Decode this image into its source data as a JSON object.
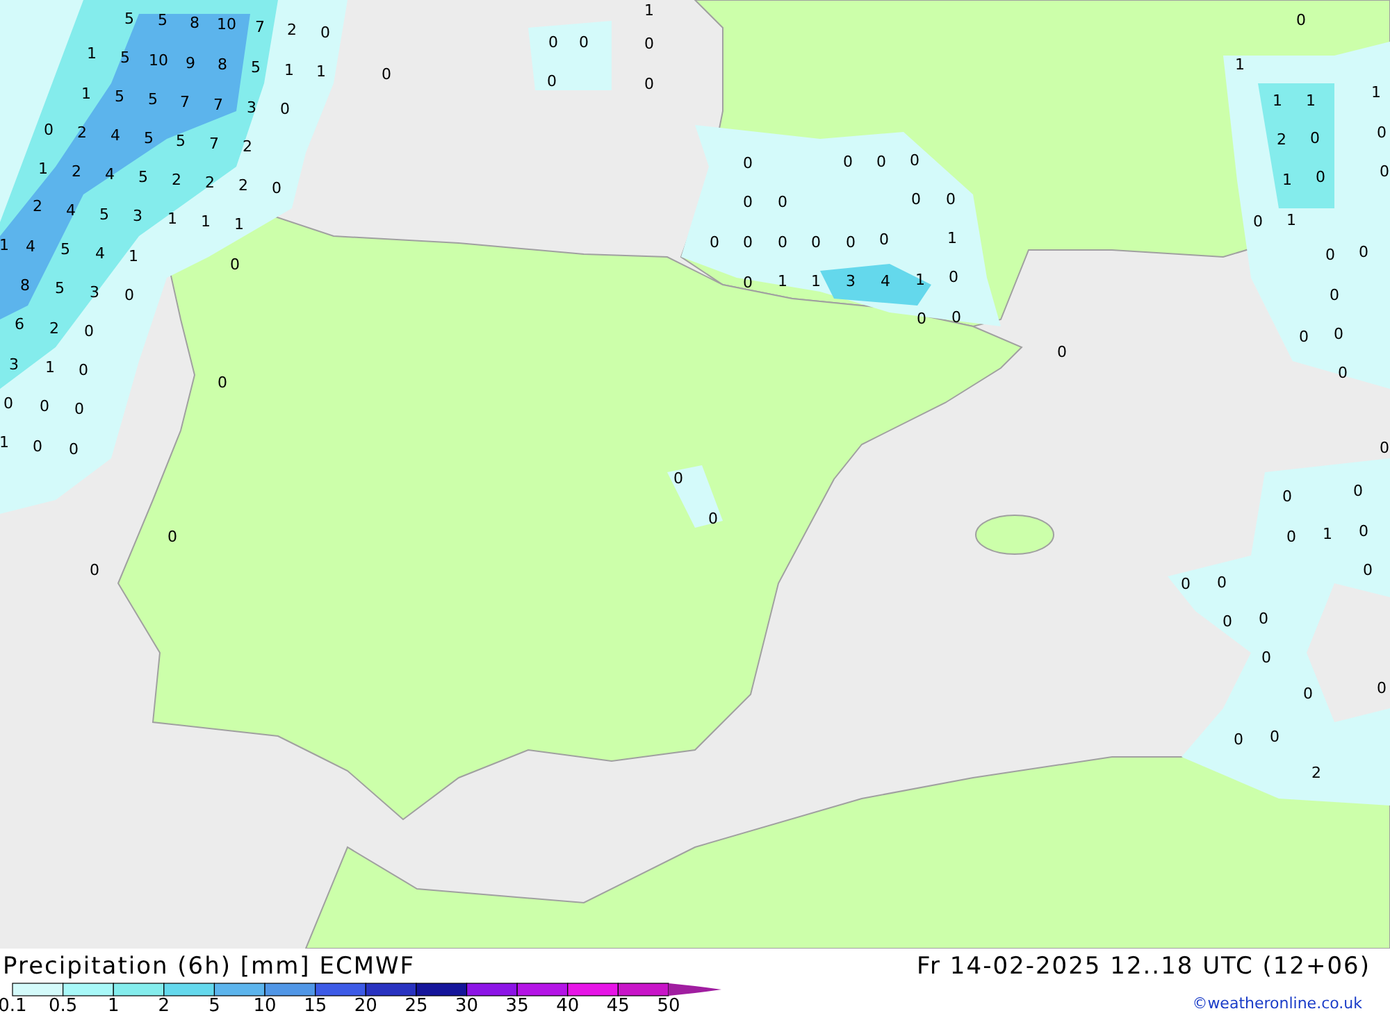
{
  "map": {
    "values": [
      "5",
      "5",
      "8",
      "10",
      "7",
      "2",
      "0",
      "1",
      "5",
      "10",
      "9",
      "8",
      "5",
      "1",
      "1",
      "0",
      "1",
      "5",
      "5",
      "7",
      "7",
      "3",
      "0",
      "0",
      "2",
      "4",
      "5",
      "5",
      "7",
      "2",
      "1",
      "2",
      "4",
      "5",
      "2",
      "2",
      "2",
      "0",
      "2",
      "4",
      "5",
      "3",
      "1",
      "1",
      "1",
      "1",
      "4",
      "5",
      "4",
      "1",
      "0",
      "8",
      "5",
      "3",
      "0",
      "6",
      "2",
      "0",
      "3",
      "1",
      "0",
      "0",
      "0",
      "0",
      "0",
      "1",
      "0",
      "0",
      "1",
      "0",
      "0",
      "0",
      "0",
      "0",
      "0",
      "0",
      "0",
      "0",
      "0",
      "0",
      "0",
      "0",
      "0",
      "0",
      "0",
      "0",
      "0",
      "0",
      "1",
      "0",
      "1",
      "1",
      "3",
      "4",
      "1",
      "0",
      "0",
      "0",
      "0",
      "0",
      "0",
      "0",
      "0",
      "0",
      "1",
      "1",
      "1",
      "2",
      "0",
      "1",
      "0",
      "0",
      "1",
      "1",
      "0",
      "0",
      "0",
      "0",
      "0",
      "0",
      "0",
      "0",
      "0",
      "0",
      "0",
      "1",
      "0",
      "0",
      "0",
      "0",
      "0",
      "0",
      "0",
      "0",
      "0",
      "0",
      "0",
      "2",
      "0"
    ]
  },
  "footer": {
    "title": "Precipitation (6h) [mm] ECMWF",
    "valid_time": "Fr 14-02-2025 12..18 UTC (12+06)",
    "credit": "©weatheronline.co.uk",
    "legend": {
      "swatches": [
        {
          "color": "#d4fafa"
        },
        {
          "color": "#a8f8f8"
        },
        {
          "color": "#84ecec"
        },
        {
          "color": "#64d8ec"
        },
        {
          "color": "#5cb4ec"
        },
        {
          "color": "#5096e6"
        },
        {
          "color": "#3c5ae6"
        },
        {
          "color": "#2832c0"
        },
        {
          "color": "#14149a"
        },
        {
          "color": "#8c14e6"
        },
        {
          "color": "#b414e6"
        },
        {
          "color": "#e614e6"
        },
        {
          "color": "#c814c8"
        }
      ],
      "arrow": {
        "color": "#a01ea0"
      },
      "labels": [
        "0.1",
        "0.5",
        "1",
        "2",
        "5",
        "10",
        "15",
        "20",
        "25",
        "30",
        "35",
        "40",
        "45",
        "50"
      ]
    }
  }
}
